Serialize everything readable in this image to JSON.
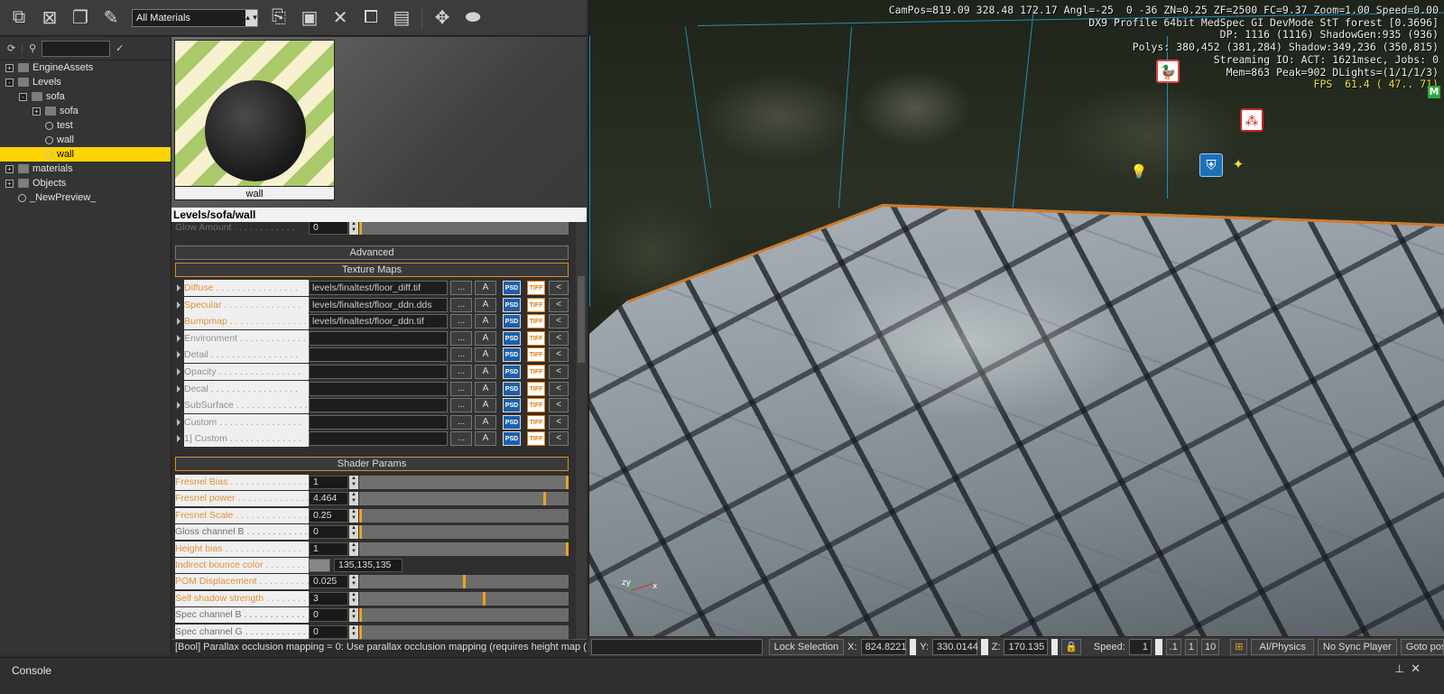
{
  "toolbar": {
    "filter_value": "All Materials",
    "icons": [
      "add-material-icon",
      "remove-material-icon",
      "clone-material-icon",
      "eyedropper-icon",
      "import-icon",
      "save-icon",
      "delete-icon",
      "copy-icon",
      "paste-icon",
      "preview-move-icon",
      "reset-view-icon"
    ]
  },
  "tree": {
    "items": [
      {
        "label": "EngineAssets",
        "level": 0,
        "expander": "+",
        "kind": "folder",
        "selected": false
      },
      {
        "label": "Levels",
        "level": 0,
        "expander": "-",
        "kind": "folder",
        "selected": false
      },
      {
        "label": "sofa",
        "level": 1,
        "expander": "-",
        "kind": "folder",
        "selected": false
      },
      {
        "label": "sofa",
        "level": 2,
        "expander": "+",
        "kind": "multi",
        "selected": false
      },
      {
        "label": "test",
        "level": 2,
        "expander": "",
        "kind": "material",
        "selected": false
      },
      {
        "label": "wall",
        "level": 2,
        "expander": "",
        "kind": "material",
        "selected": false
      },
      {
        "label": "wall",
        "level": 2,
        "expander": "",
        "kind": "material",
        "selected": true
      },
      {
        "label": "materials",
        "level": 0,
        "expander": "+",
        "kind": "folder",
        "selected": false
      },
      {
        "label": "Objects",
        "level": 0,
        "expander": "+",
        "kind": "folder",
        "selected": false
      },
      {
        "label": "_NewPreview_",
        "level": 0,
        "expander": "",
        "kind": "material",
        "selected": false
      }
    ]
  },
  "preview": {
    "label": "wall"
  },
  "path": "Levels/sofa/wall",
  "glow": {
    "label": "Glow Amount . . . . . . . . . . . .",
    "value": "0"
  },
  "sections": {
    "advanced": "Advanced",
    "texture_maps": "Texture Maps",
    "shader_params": "Shader Params"
  },
  "textures": [
    {
      "label": "Diffuse . . . . . . . . . . . . . . . .",
      "path": "levels/finaltest/floor_diff.tif",
      "active": true
    },
    {
      "label": "Specular . . . . . . . . . . . . . . .",
      "path": "levels/finaltest/floor_ddn.dds",
      "active": true
    },
    {
      "label": "Bumpmap . . . . . . . . . . . . . . .",
      "path": "levels/finaltest/floor_ddn.tif",
      "active": true
    },
    {
      "label": "Environment . . . . . . . . . . . . .",
      "path": "",
      "active": false
    },
    {
      "label": "Detail . . . . . . . . . . . . . . . . .",
      "path": "",
      "active": false
    },
    {
      "label": "Opacity . . . . . . . . . . . . . . . .",
      "path": "",
      "active": false
    },
    {
      "label": "Decal . . . . . . . . . . . . . . . . .",
      "path": "",
      "active": false
    },
    {
      "label": "SubSurface . . . . . . . . . . . . . .",
      "path": "",
      "active": false
    },
    {
      "label": "Custom . . . . . . . . . . . . . . . .",
      "path": "",
      "active": false
    },
    {
      "label": "1] Custom . . . . . . . . . . . . . .",
      "path": "",
      "active": false
    }
  ],
  "texture_buttons": {
    "browse": "...",
    "a": "A",
    "psd": "PSD",
    "tiff": "TIFF",
    "back": "<"
  },
  "shader_params": [
    {
      "label": "Fresnel Bias . . . . . . . . . . . . . . . .",
      "value": "1",
      "level": 1.0,
      "active": true
    },
    {
      "label": "Fresnel power . . . . . . . . . . . . . .",
      "value": "4.464",
      "level": 0.89,
      "active": true
    },
    {
      "label": "Fresnel Scale . . . . . . . . . . . . . .",
      "value": "0.25",
      "level": 0.0,
      "active": true
    },
    {
      "label": "Gloss channel B . . . . . . . . . . . .",
      "value": "0",
      "level": 0.0,
      "active": false
    },
    {
      "label": "Height bias . . . . . . . . . . . . . . .",
      "value": "1",
      "level": 1.0,
      "active": true
    },
    {
      "label": "Indirect bounce color . . . . . . . . .",
      "value": "135,135,135",
      "level": null,
      "active": true,
      "color": "#878787"
    },
    {
      "label": "POM Displacement . . . . . . . . . . .",
      "value": "0.025",
      "level": 0.5,
      "active": true
    },
    {
      "label": "Self shadow strength . . . . . . . . .",
      "value": "3",
      "level": 0.6,
      "active": true
    },
    {
      "label": "Spec channel B . . . . . . . . . . . .",
      "value": "0",
      "level": 0.0,
      "active": false
    },
    {
      "label": "Spec channel G . . . . . . . . . . . .",
      "value": "0",
      "level": 0.0,
      "active": false
    }
  ],
  "status": "[Bool] Parallax occlusion mapping = 0: Use parallax occlusion mapping (requires height map (_displ))",
  "hud": {
    "lines": [
      "CamPos=819.09 328.48 172.17 Angl=-25  0 -36 ZN=0.25 ZF=2500 FC=9.37 Zoom=1.00 Speed=0.00",
      "DX9 Profile 64bit MedSpec GI DevMode StT forest [0.3696]",
      "DP: 1116 (1116) ShadowGen:935 (936)",
      "Polys: 380,452 (381,284) Shadow:349,236 (350,815)",
      "Streaming IO: ACT: 1621msec, Jobs: 0",
      "Mem=863 Peak=902 DLights=(1/1/1/3)"
    ],
    "fps": "FPS  61.4 ( 47.. 71)",
    "badge": "M"
  },
  "axis": {
    "zy": "zy",
    "x": "x"
  },
  "viewport_bar": {
    "lock_selection": "Lock Selection",
    "x_label": "X:",
    "x_value": "824.8221",
    "y_label": "Y:",
    "y_value": "330.0144",
    "z_label": "Z:",
    "z_value": "170.135",
    "speed_label": "Speed:",
    "speed_value": "1",
    "speed_presets": [
      ".1",
      "1",
      "10"
    ],
    "ai_physics": "AI/Physics",
    "no_sync": "No Sync Player",
    "goto": "Goto posi"
  },
  "console": {
    "title": "Console"
  }
}
